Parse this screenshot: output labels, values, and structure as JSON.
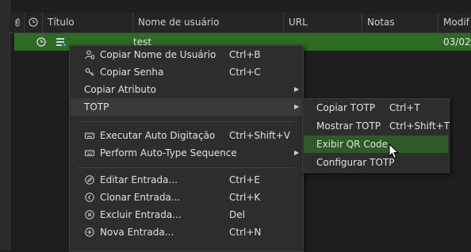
{
  "header": {
    "columns": [
      "Título",
      "Nome de usuário",
      "URL",
      "Notas",
      "Modif"
    ]
  },
  "row": {
    "username": "test",
    "modified": "03/02/"
  },
  "context_menu": {
    "items": [
      {
        "label": "Copiar Nome de Usuário",
        "shortcut": "Ctrl+B"
      },
      {
        "label": "Copiar Senha",
        "shortcut": "Ctrl+C"
      },
      {
        "label": "Copiar Atributo",
        "shortcut": ""
      },
      {
        "label": "TOTP",
        "shortcut": ""
      },
      {
        "label": "Executar Auto Digitação",
        "shortcut": "Ctrl+Shift+V"
      },
      {
        "label": "Perform Auto-Type Sequence",
        "shortcut": ""
      },
      {
        "label": "Editar Entrada...",
        "shortcut": "Ctrl+E"
      },
      {
        "label": "Clonar Entrada...",
        "shortcut": "Ctrl+K"
      },
      {
        "label": "Excluir Entrada...",
        "shortcut": "Del"
      },
      {
        "label": "Nova Entrada...",
        "shortcut": "Ctrl+N"
      }
    ]
  },
  "totp_submenu": {
    "items": [
      {
        "label": "Copiar TOTP",
        "shortcut": "Ctrl+T"
      },
      {
        "label": "Mostrar TOTP",
        "shortcut": "Ctrl+Shift+T"
      },
      {
        "label": "Exibir QR Code",
        "shortcut": ""
      },
      {
        "label": "Configurar TOTP",
        "shortcut": ""
      }
    ]
  },
  "colors": {
    "selection_green": "#2e6b25",
    "highlight_green": "#2e5a27",
    "menu_bg": "#2d2d2d"
  }
}
